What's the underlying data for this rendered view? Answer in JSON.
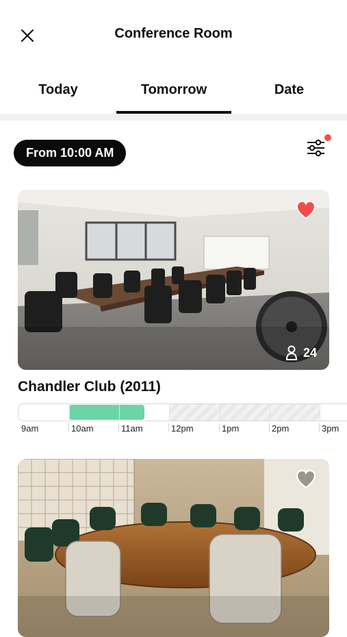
{
  "header": {
    "title": "Conference Room"
  },
  "tabs": [
    {
      "label": "Today"
    },
    {
      "label": "Tomorrow"
    },
    {
      "label": "Date"
    }
  ],
  "filters": {
    "time_pill": "From 10:00 AM"
  },
  "rooms": [
    {
      "name": "Chandler Club (2011)",
      "capacity": "24",
      "favorite": true,
      "timeline": {
        "labels": [
          "9am",
          "10am",
          "11am",
          "12pm",
          "1pm",
          "2pm",
          "3pm"
        ]
      }
    },
    {
      "favorite": false
    }
  ],
  "colors": {
    "accent": "#0a0a0a",
    "booked": "#6ed3a9",
    "favorite_red": "#f24d4d",
    "notification_dot": "#f24d4d"
  },
  "icons": {
    "close": "close-icon",
    "filter": "sliders-icon",
    "favorite_filled": "heart-filled-icon",
    "favorite_outline": "heart-outline-icon",
    "capacity": "person-icon"
  }
}
